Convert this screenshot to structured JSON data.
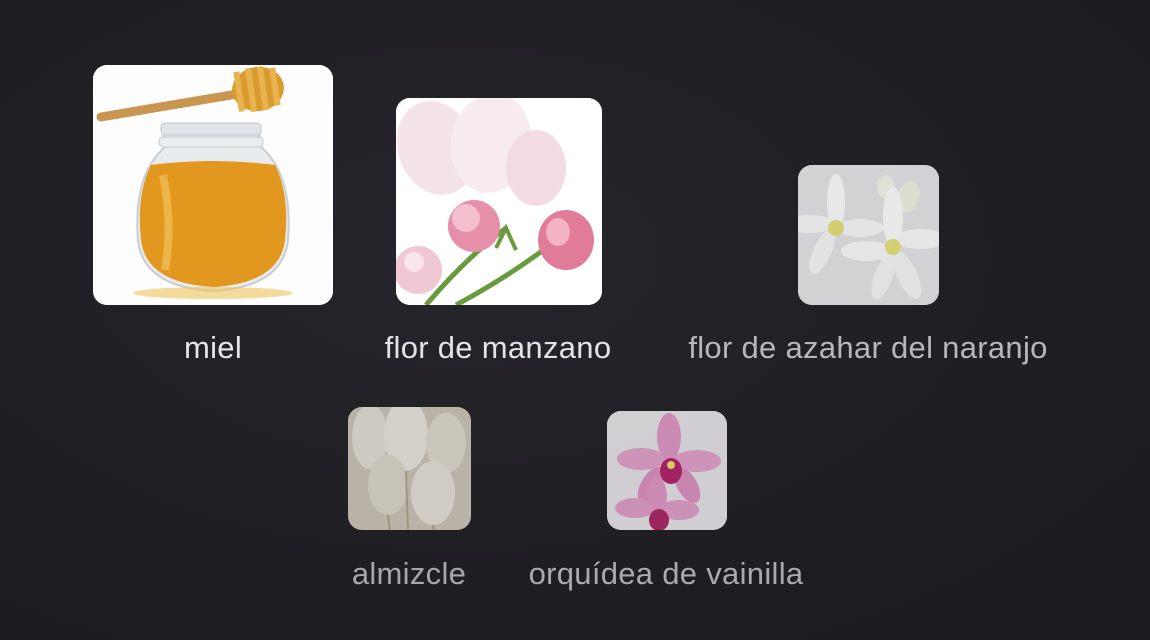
{
  "notes": [
    {
      "id": "miel",
      "label": "miel",
      "image": "honey-jar-icon",
      "label_color": "#e6e6e8"
    },
    {
      "id": "manzano",
      "label": "flor de manzano",
      "image": "apple-blossom-icon",
      "label_color": "#e3e3e5"
    },
    {
      "id": "azahar",
      "label": "flor de azahar del naranjo",
      "image": "orange-blossom-icon",
      "label_color": "#b7b7bb"
    },
    {
      "id": "almizcle",
      "label": "almizcle",
      "image": "musk-plumes-icon",
      "label_color": "#a7a7ab"
    },
    {
      "id": "orquidea",
      "label": "orquídea de vainilla",
      "image": "vanilla-orchid-icon",
      "label_color": "#aaaaae"
    }
  ]
}
